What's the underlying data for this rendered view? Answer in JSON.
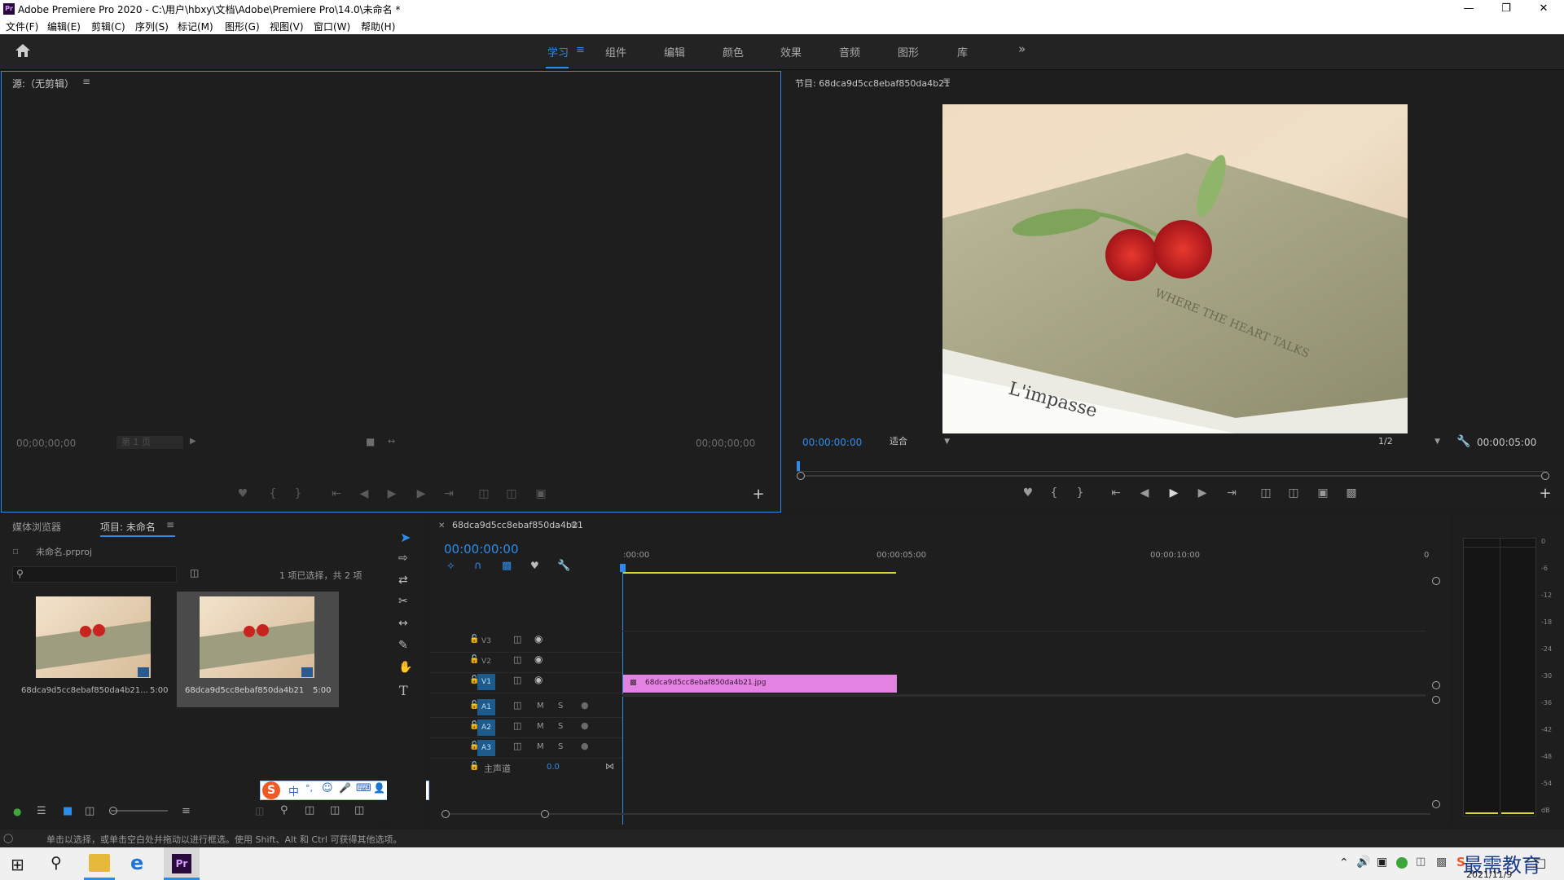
{
  "window": {
    "title": "Adobe Premiere Pro 2020 - C:\\用户\\hbxy\\文档\\Adobe\\Premiere Pro\\14.0\\未命名 *",
    "app_badge": "Pr"
  },
  "menu": [
    "文件(F)",
    "编辑(E)",
    "剪辑(C)",
    "序列(S)",
    "标记(M)",
    "图形(G)",
    "视图(V)",
    "窗口(W)",
    "帮助(H)"
  ],
  "workspaces": {
    "active": "学习",
    "items": [
      "组件",
      "编辑",
      "颜色",
      "效果",
      "音频",
      "图形",
      "库"
    ]
  },
  "source": {
    "title": "源:（无剪辑）",
    "tc_left": "00;00;00;00",
    "page": "第 1 页",
    "tc_right": "00;00;00;00"
  },
  "program": {
    "title": "节目: 68dca9d5cc8ebaf850da4b21",
    "tc": "00:00:00:00",
    "fit": "适合",
    "res": "1/2",
    "duration": "00:00:05:00"
  },
  "project": {
    "tab_media": "媒体浏览器",
    "tab_project": "项目: 未命名",
    "file": "未命名.prproj",
    "count": "1 项已选择，共 2 项",
    "items": [
      {
        "name": "68dca9d5cc8ebaf850da4b21...",
        "dur": "5:00"
      },
      {
        "name": "68dca9d5cc8ebaf850da4b21",
        "dur": "5:00"
      }
    ]
  },
  "timeline": {
    "tab": "68dca9d5cc8ebaf850da4b21",
    "tc": "00:00:00:00",
    "ruler": [
      ":00:00",
      "00:00:05:00",
      "00:00:10:00",
      "0"
    ],
    "video_tracks": [
      "V3",
      "V2",
      "V1"
    ],
    "audio_tracks": [
      "A1",
      "A2",
      "A3"
    ],
    "mute_label": "M",
    "solo_label": "S",
    "master": "主声道",
    "master_val": "0.0",
    "clip": "68dca9d5cc8ebaf850da4b21.jpg"
  },
  "meter": {
    "scale": [
      "0",
      "-6",
      "-12",
      "-18",
      "-24",
      "-30",
      "-36",
      "-42",
      "-48",
      "-54",
      "dB"
    ]
  },
  "ime": {
    "items": [
      "中",
      "°,",
      "☺",
      "🎤",
      "⌨",
      "👤",
      "👕",
      "▦"
    ]
  },
  "status": "单击以选择，或单击空白处并拖动以进行框选。使用 Shift、Alt 和 Ctrl 可获得其他选项。",
  "taskbar": {
    "date": "2021/11/9",
    "watermark": "最需教育",
    "logo_badge": "Pr"
  },
  "colors": {
    "accent": "#2d8ceb",
    "clip": "#e382e0",
    "tab_active": "#2d8ceb"
  }
}
